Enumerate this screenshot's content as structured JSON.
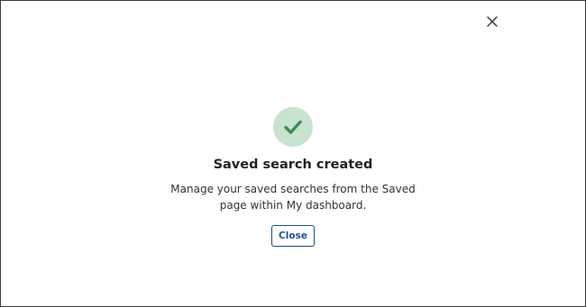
{
  "dialog": {
    "title": "Saved search created",
    "message": "Manage your saved searches from the Saved page within My dashboard.",
    "close_button_label": "Close",
    "icons": {
      "close": "close-icon",
      "status": "checkmark-icon"
    },
    "colors": {
      "success_bg": "#c8e3cf",
      "success_check": "#3f8a55",
      "button_accent": "#1f4e9c"
    }
  }
}
